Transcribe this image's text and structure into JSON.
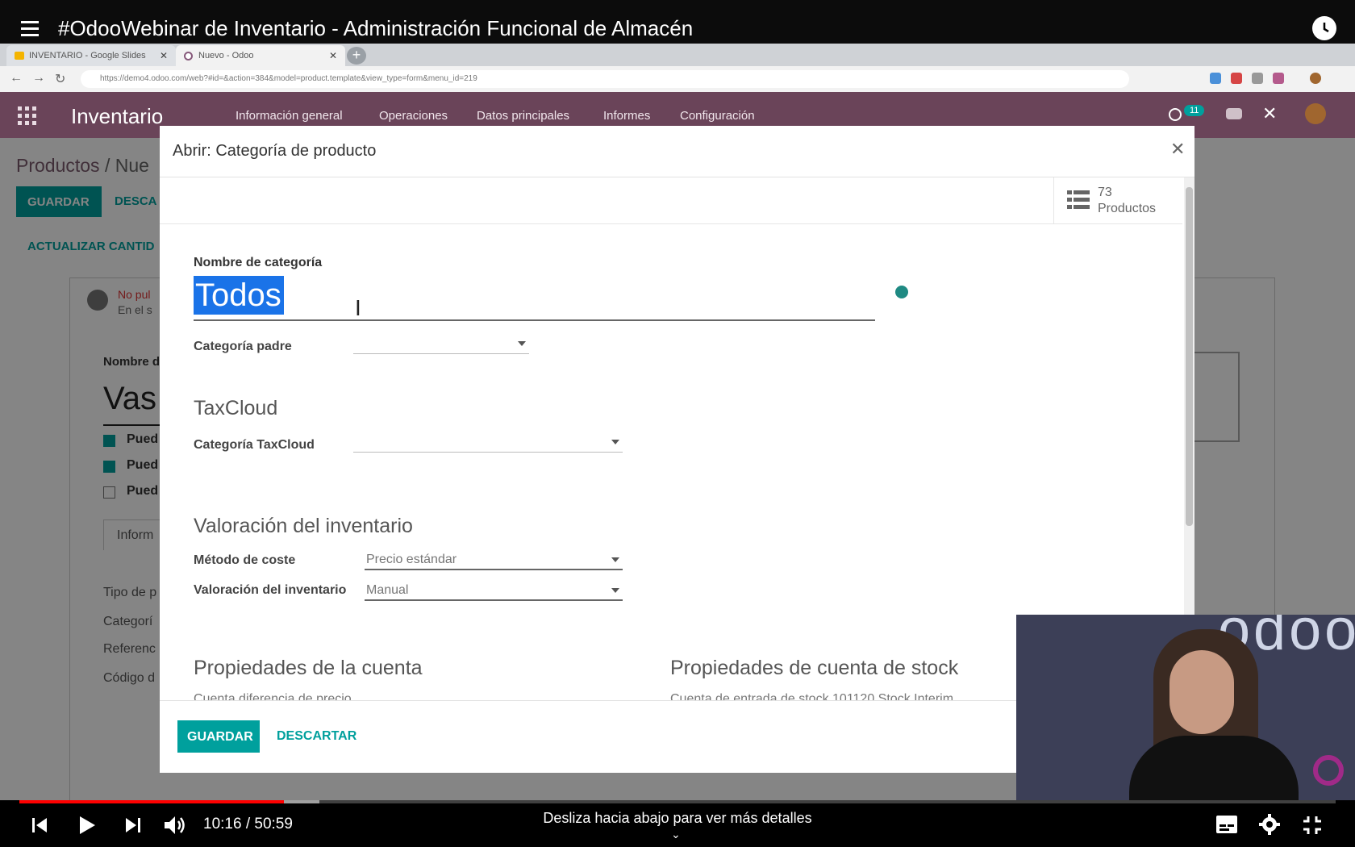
{
  "player": {
    "title": "#OdooWebinar de Inventario - Administración Funcional de Almacén",
    "time_current": "10:16",
    "time_total": "50:59",
    "time_display": "10:16 / 50:59",
    "progress_played": 0.201,
    "progress_buffered": 0.228,
    "scroll_hint": "Desliza hacia abajo para ver más detalles"
  },
  "browser": {
    "tabs": [
      {
        "label": "INVENTARIO - Google Slides"
      },
      {
        "label": "Nuevo - Odoo"
      }
    ],
    "url": "https://demo4.odoo.com/web?#id=&action=384&model=product.template&view_type=form&menu_id=219"
  },
  "odoo": {
    "app_name": "Inventario",
    "menu": [
      "Información general",
      "Operaciones",
      "Datos principales",
      "Informes",
      "Configuración"
    ],
    "notif_count": "11",
    "breadcrumb_root": "Productos",
    "breadcrumb_sep": " / ",
    "breadcrumb_current": "Nue",
    "save_label": "GUARDAR",
    "discard_label": "DESCA",
    "update_qty_label": "ACTUALIZAR CANTID",
    "not_published": "No pul",
    "not_published_sub": "En el s",
    "name_label": "Nombre d",
    "product_name": "Vas",
    "checkboxes": [
      {
        "label": "Pued",
        "checked": true
      },
      {
        "label": "Pued",
        "checked": true
      },
      {
        "label": "Pued",
        "checked": false
      }
    ],
    "tab_label": "Inform",
    "fields": [
      "Tipo de p",
      "Categorí",
      "Referenc",
      "Código d"
    ]
  },
  "modal": {
    "title": "Abrir: Categoría de producto",
    "stat_count": "73",
    "stat_label": "Productos",
    "category_name_label": "Nombre de categoría",
    "category_name_value": "Todos",
    "parent_label": "Categoría padre",
    "parent_value": "",
    "taxcloud_section": "TaxCloud",
    "taxcloud_label": "Categoría TaxCloud",
    "taxcloud_value": "",
    "valuation_section": "Valoración del inventario",
    "cost_method_label": "Método de coste",
    "cost_method_value": "Precio estándar",
    "inventory_valuation_label": "Valoración del inventario",
    "inventory_valuation_value": "Manual",
    "account_section": "Propiedades de la cuenta",
    "account_cut": "Cuenta diferencia de precio",
    "stock_account_section": "Propiedades de cuenta de stock",
    "stock_account_cut": "Cuenta de entrada de stock   101120 Stock Interim",
    "save_label": "GUARDAR",
    "discard_label": "DESCARTAR"
  },
  "colors": {
    "odoo_primary": "#00a09d",
    "odoo_header": "#6a4459",
    "youtube_red": "#ff0000",
    "selection": "#1a73e8"
  }
}
